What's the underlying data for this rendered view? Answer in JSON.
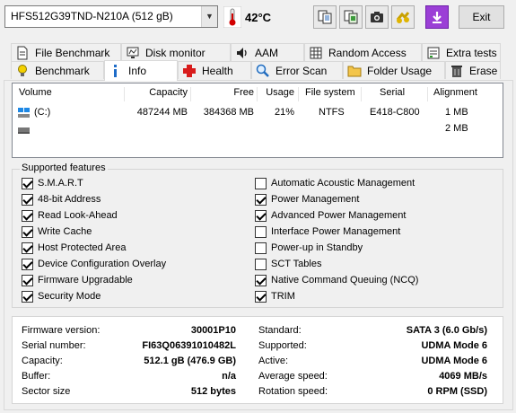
{
  "toolbar": {
    "drive": "HFS512G39TND-N210A (512 gB)",
    "temperature": "42°C",
    "exit_label": "Exit",
    "icons": [
      "copy-icon",
      "copy-to-clipboard-icon",
      "camera-icon",
      "compare-icon",
      "save-icon"
    ]
  },
  "tabs": {
    "row1": [
      "File Benchmark",
      "Disk monitor",
      "AAM",
      "Random Access",
      "Extra tests"
    ],
    "row2": [
      "Benchmark",
      "Info",
      "Health",
      "Error Scan",
      "Folder Usage",
      "Erase"
    ],
    "active": "Info"
  },
  "volumes": {
    "headers": [
      "Volume",
      "Capacity",
      "Free",
      "Usage",
      "File system",
      "Serial",
      "Alignment"
    ],
    "rows": [
      {
        "volume": "(C:)",
        "capacity": "487244 MB",
        "free": "384368 MB",
        "usage": "21%",
        "fs": "NTFS",
        "serial": "E418-C800",
        "alignment": "1 MB"
      },
      {
        "volume": "",
        "capacity": "",
        "free": "",
        "usage": "",
        "fs": "",
        "serial": "",
        "alignment": "2 MB"
      }
    ]
  },
  "features": {
    "legend": "Supported features",
    "left": [
      {
        "label": "S.M.A.R.T",
        "checked": true
      },
      {
        "label": "48-bit Address",
        "checked": true
      },
      {
        "label": "Read Look-Ahead",
        "checked": true
      },
      {
        "label": "Write Cache",
        "checked": true
      },
      {
        "label": "Host Protected Area",
        "checked": true
      },
      {
        "label": "Device Configuration Overlay",
        "checked": true
      },
      {
        "label": "Firmware Upgradable",
        "checked": true
      },
      {
        "label": "Security Mode",
        "checked": true
      }
    ],
    "right": [
      {
        "label": "Automatic Acoustic Management",
        "checked": false
      },
      {
        "label": "Power Management",
        "checked": true
      },
      {
        "label": "Advanced Power Management",
        "checked": true
      },
      {
        "label": "Interface Power Management",
        "checked": false
      },
      {
        "label": "Power-up in Standby",
        "checked": false
      },
      {
        "label": "SCT Tables",
        "checked": false
      },
      {
        "label": "Native Command Queuing (NCQ)",
        "checked": true
      },
      {
        "label": "TRIM",
        "checked": true
      }
    ]
  },
  "info": {
    "left": [
      {
        "label": "Firmware version:",
        "value": "30001P10"
      },
      {
        "label": "Serial number:",
        "value": "FI63Q06391010482L"
      },
      {
        "label": "Capacity:",
        "value": "512.1 gB (476.9 GB)"
      },
      {
        "label": "Buffer:",
        "value": "n/a"
      },
      {
        "label": "Sector size",
        "value": "512 bytes"
      }
    ],
    "right": [
      {
        "label": "Standard:",
        "value": "SATA 3 (6.0 Gb/s)"
      },
      {
        "label": "Supported:",
        "value": "UDMA Mode 6"
      },
      {
        "label": "Active:",
        "value": "UDMA Mode 6"
      },
      {
        "label": "Average speed:",
        "value": "4069 MB/s"
      },
      {
        "label": "Rotation speed:",
        "value": "0 RPM (SSD)"
      }
    ]
  }
}
